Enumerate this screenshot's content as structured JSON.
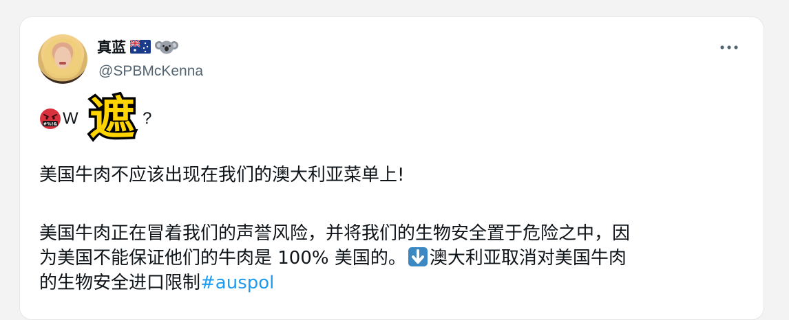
{
  "tweet": {
    "author": {
      "display_name": "真蓝",
      "flag_icon": "australia-flag-icon",
      "emoji_icon": "koala-icon",
      "handle": "@SPBMcKenna"
    },
    "more_icon": "more-options-icon",
    "first_line": {
      "emoji_icon": "face-with-symbols-on-mouth-icon",
      "lead_text": "W",
      "sticker_text": "遮",
      "tail_text": "?"
    },
    "paragraph_1": "美国牛肉不应该出现在我们的澳大利亚菜单上!",
    "paragraph_2": {
      "line_1": "美国牛肉正在冒着我们的声誉风险，并将我们的生物安全置于危险之中，因",
      "line_2_before_icon": "为美国不能保证他们的牛肉是 100% 美国的。",
      "icon": "down-arrow-icon",
      "line_2_after_icon": "澳大利亚取消对美国牛肉",
      "line_3": "的生物安全进口限制",
      "hashtag": "#auspol"
    },
    "colors": {
      "hashtag": "#1d9bf0",
      "handle": "#536471",
      "sticker_fill": "#ffd400",
      "sticker_stroke": "#000000"
    }
  }
}
